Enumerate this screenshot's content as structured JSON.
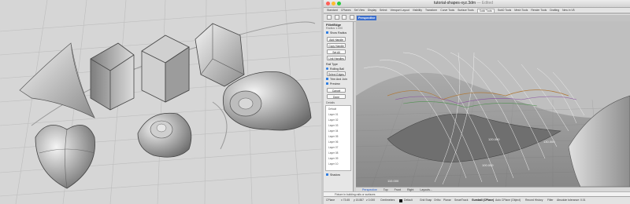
{
  "window": {
    "title": "tutorial-shapes-xyz.3dm",
    "edited": "— Edited"
  },
  "tabs": [
    "Standard",
    "CPlanes",
    "Set View",
    "Display",
    "Select",
    "Viewport Layout",
    "Visibility",
    "Transform",
    "Curve Tools",
    "Surface Tools",
    "Solid Tools",
    "SubD Tools",
    "Mesh Tools",
    "Render Tools",
    "Drafting",
    "New in V8"
  ],
  "active_tab": "Solid Tools",
  "command_panel": {
    "title": "FilletEdge",
    "subtitle": "Radius 1.000",
    "show_radius": "Show Radius",
    "add_handle": "Add Handle",
    "copy_handle": "Copy Handle",
    "set_all": "Set All",
    "link_handles": "Link Handles",
    "rail_type": "Rail Type",
    "rail_option": "Rolling Ball",
    "select_edges": "Select Edges",
    "trim_and_join": "Trim And Join",
    "preview": "Preview",
    "cancel": "Cancel",
    "done": "Done",
    "layers_header": "Details",
    "layers": [
      "Default",
      "Layer 01",
      "Layer 02",
      "Layer 03",
      "Layer 04",
      "Layer 05",
      "Layer 06",
      "Layer 07",
      "Layer 08",
      "Layer 09",
      "Layer 10"
    ],
    "display_checkbox": "Shadow"
  },
  "viewport": {
    "label": "Perspective"
  },
  "view_tabs": [
    "Perspective",
    "Top",
    "Front",
    "Right",
    "Layouts..."
  ],
  "command_line": {
    "text": "Fixture in building rails or surfaces"
  },
  "status_bar": {
    "cplane": "CPlane",
    "x": "x 73.65",
    "y": "y 15.887",
    "z": "z 0.000",
    "units": "Centimeters",
    "layer": "Default",
    "grid_snap": "Grid Snap",
    "ortho": "Ortho",
    "planar": "Planar",
    "smarttrack": "SmartTrack",
    "gumball": "Gumball (CPlane)",
    "auto_cplane": "Auto CPlane (Object)",
    "record_history": "Record History",
    "filter": "Filter",
    "tolerance": "Absolute tolerance: 0.01"
  },
  "labels": {
    "coord_1": "120.000",
    "coord_2": "130.000",
    "coord_3": "100.000",
    "coord_4": "110.000"
  },
  "colors": {
    "viewport_label_bg": "#3b6ecd",
    "checkbox_blue": "#2f7de1",
    "close_red": "#ff5f57",
    "minimize_yellow": "#febc2e",
    "zoom_green": "#28c840"
  }
}
